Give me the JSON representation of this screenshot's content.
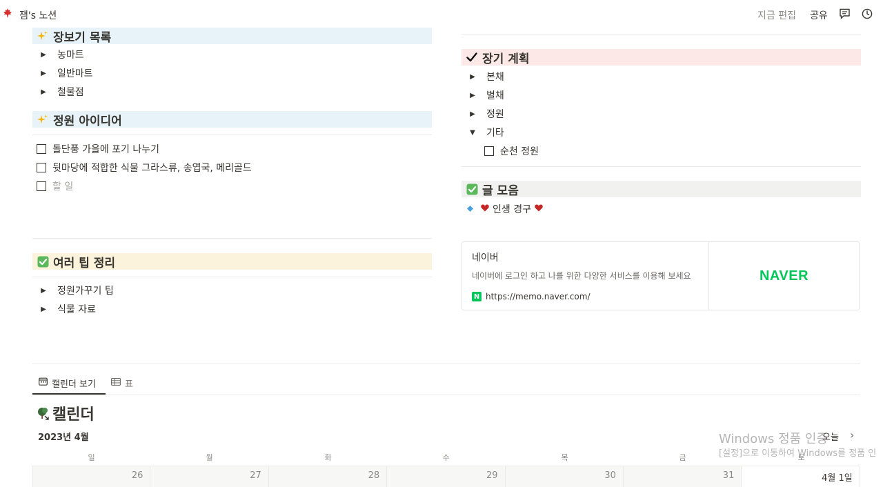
{
  "topbar": {
    "workspace_title": "잼's 노션",
    "edit_time": "지금 편집",
    "share_label": "공유",
    "icons": [
      "maple-leaf-icon",
      "comment-icon",
      "clock-icon"
    ]
  },
  "left": {
    "shopping": {
      "heading": "장보기 목록",
      "items": [
        "농마트",
        "일반마트",
        "철물점"
      ]
    },
    "garden": {
      "heading": "정원 아이디어",
      "todos": [
        "돌단풍 가을에 포기 나누기",
        "뒷마당에 적합한 식물 그라스류, 송엽국, 메리골드"
      ],
      "placeholder": "할 일"
    },
    "tips": {
      "heading": "여러 팁 정리",
      "items": [
        "정원가꾸기 팁",
        "식물 자료"
      ]
    }
  },
  "right": {
    "plan": {
      "heading": "장기 계획",
      "items": [
        "본채",
        "별채",
        "정원",
        "기타"
      ],
      "sub_todo": "순천 정원"
    },
    "writings": {
      "heading": "글 모음",
      "item": "인생 경구"
    },
    "bookmark": {
      "title": "네이버",
      "description": "네이버에 로그인 하고 나를 위한 다양한 서비스를 이용해 보세요",
      "url": "https://memo.naver.com/",
      "logo_text": "NAVER"
    }
  },
  "views": {
    "tabs": [
      "캘린더 보기",
      "표"
    ]
  },
  "calendar": {
    "title": "캘린더",
    "month": "2023년 4월",
    "today_label": "오늘",
    "weekdays": [
      "일",
      "월",
      "화",
      "수",
      "목",
      "금",
      "토"
    ],
    "first_row": [
      "26",
      "27",
      "28",
      "29",
      "30",
      "31",
      "4월 1일"
    ]
  },
  "watermark": {
    "line1": "Windows 정품 인증",
    "line2": "[설정]으로 이동하여 Windows를 정품 인"
  },
  "colors": {
    "blue_heading": "#e7f3f8",
    "yellow_heading": "#fbf3db",
    "red_heading": "#fde8e8",
    "gray_heading": "#f1f1ef",
    "naver_green": "#03c75a"
  }
}
